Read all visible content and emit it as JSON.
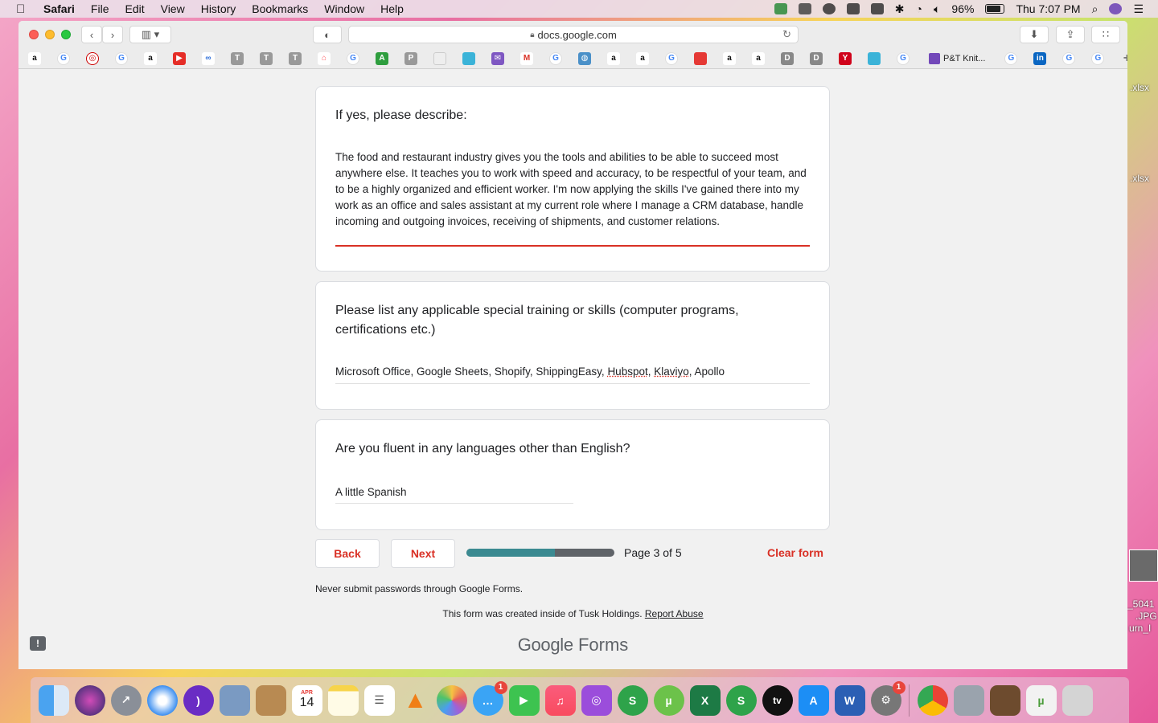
{
  "menubar": {
    "app": "Safari",
    "menus": [
      "File",
      "Edit",
      "View",
      "History",
      "Bookmarks",
      "Window",
      "Help"
    ],
    "battery": "96%",
    "clock": "Thu 7:07 PM"
  },
  "browser": {
    "url": "docs.google.com",
    "bookmark_tab_label": "P&T Knit..."
  },
  "form": {
    "q1": {
      "title": "If yes, please describe:",
      "answer": "The food and restaurant industry gives you the tools and abilities to be able to succeed most anywhere else. It teaches you to work with speed and accuracy, to be respectful of your team, and to be a highly organized and efficient worker. I'm now applying the skills I've gained there into my work as an office and sales assistant at my current role where I manage a CRM database, handle incoming and outgoing invoices, receiving of shipments, and customer relations."
    },
    "q2": {
      "title": "Please list any applicable special training or skills (computer programs, certifications etc.)",
      "answer_part1": "Microsoft Office, Google Sheets, Shopify, ShippingEasy, ",
      "answer_hubspot": "Hubspot",
      "answer_sep": ", ",
      "answer_klaviyo": "Klaviyo",
      "answer_part2": ", Apollo"
    },
    "q3": {
      "title": "Are you fluent in any languages other than English?",
      "answer": "A little Spanish"
    },
    "nav": {
      "back": "Back",
      "next": "Next",
      "progress": 0.6,
      "page_label": "Page 3 of 5",
      "clear": "Clear form"
    },
    "footnote": "Never submit passwords through Google Forms.",
    "created_text": "This form was created inside of Tusk Holdings. ",
    "report_abuse": "Report Abuse",
    "brand_google": "Google",
    "brand_forms": "Forms"
  },
  "desktop": {
    "file1": ".xlsx",
    "file2": ".xlsx",
    "file3_line1": "_5041",
    "file3_line2": ".JPG",
    "file3_line3": "urn_I"
  },
  "dock": {
    "calendar_month": "APR",
    "calendar_day": "14",
    "messages_badge": "1",
    "prefs_badge": "1",
    "tv_label": "tv"
  },
  "colors": {
    "accent": "#d93025",
    "progress_fill": "#3b8a91",
    "progress_track": "#5f6368"
  }
}
